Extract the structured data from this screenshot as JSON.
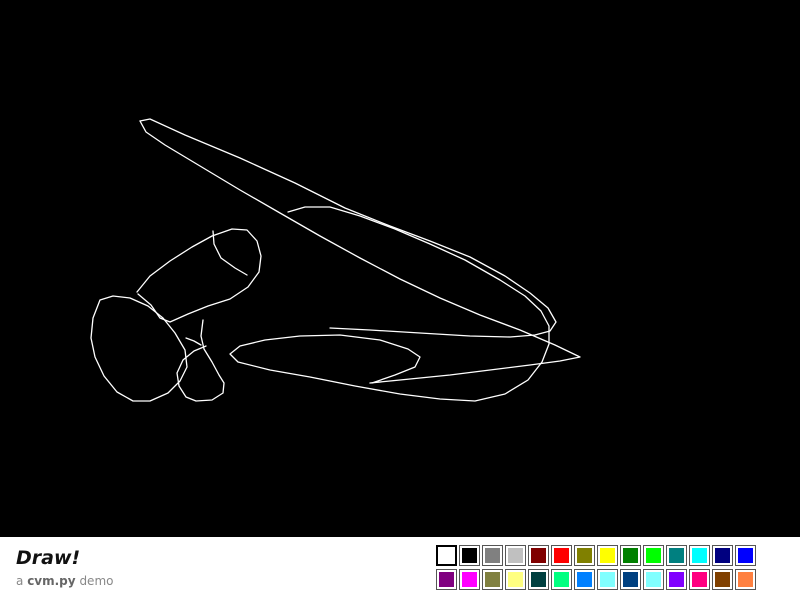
{
  "app": {
    "title": "Draw!",
    "subtitle_prefix": "a",
    "subtitle_module": "cvm.py",
    "subtitle_suffix": "demo"
  },
  "canvas": {
    "background": "#000000",
    "stroke_color": "#ffffff"
  },
  "palette": {
    "selected_index": 0,
    "colors": [
      "#ffffff",
      "#000000",
      "#808080",
      "#c0c0c0",
      "#800000",
      "#ff0000",
      "#808000",
      "#ffff00",
      "#008000",
      "#00ff00",
      "#008080",
      "#00ffff",
      "#000080",
      "#0000ff",
      "#800080",
      "#ff00ff",
      "#808040",
      "#ffff80",
      "#004040",
      "#00ff80",
      "#0080ff",
      "#80ffff",
      "#004080",
      "#80ffff",
      "#8000ff",
      "#ff0080",
      "#804000",
      "#ff8040"
    ]
  }
}
